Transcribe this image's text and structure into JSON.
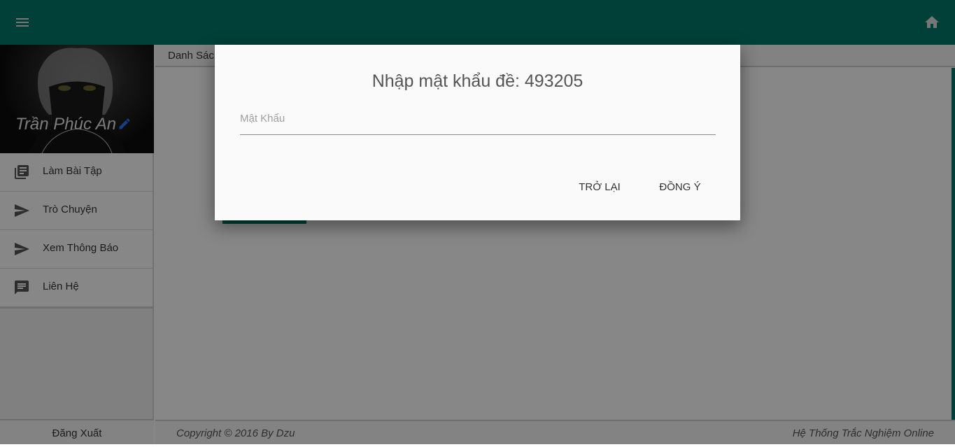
{
  "header": {
    "menu_icon": "menu-icon",
    "home_icon": "home-icon",
    "color": "#00796b"
  },
  "sidebar": {
    "profile_name": "Trần Phúc An",
    "items": [
      {
        "label": "Làm Bài Tập",
        "icon": "library-books-icon"
      },
      {
        "label": "Trò Chuyện",
        "icon": "send-icon"
      },
      {
        "label": "Xem Thông Báo",
        "icon": "send-icon"
      },
      {
        "label": "Liên Hệ",
        "icon": "message-icon"
      }
    ],
    "logout_label": "Đăng Xuất"
  },
  "main": {
    "title": "Danh Sách"
  },
  "footer": {
    "copyright": "Copyright © 2016 By Dzu",
    "system_name": "Hệ Thống Trắc Nghiệm Online"
  },
  "dialog": {
    "title": "Nhập mật khẩu đề: 493205",
    "password_placeholder": "Mật Khẩu",
    "password_value": "",
    "back_label": "TRỞ LẠI",
    "ok_label": "ĐỒNG Ý"
  }
}
